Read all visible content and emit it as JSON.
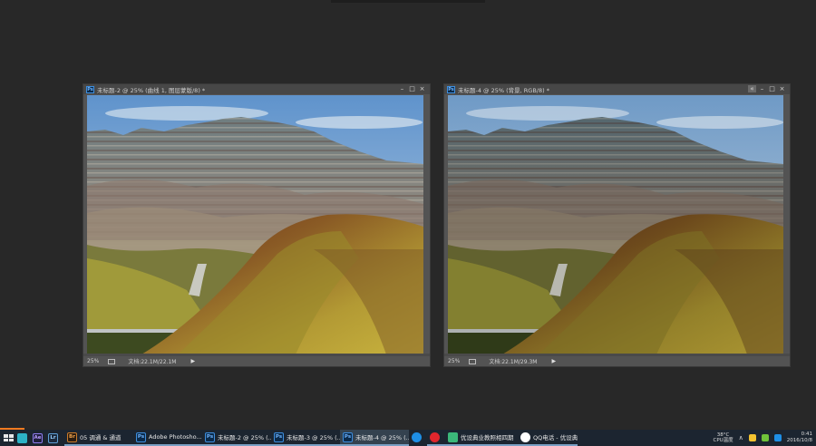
{
  "windows": [
    {
      "title": "未标题-2 @ 25% (曲线 1, 图层蒙版/8) *",
      "ps_icon": "Ps",
      "controls": [
        "–",
        "□",
        "×"
      ],
      "zoom": "25%",
      "doc_size": "文档:22.1M/22.1M",
      "arrow": "▶"
    },
    {
      "title": "未标题-4 @ 25% (背景, RGB/8) *",
      "ps_icon": "Ps",
      "controls": [
        "«",
        "–",
        "□",
        "×"
      ],
      "zoom": "25%",
      "doc_size": "文档:22.1M/29.3M",
      "arrow": "▶"
    }
  ],
  "taskbar": {
    "pinned": [
      {
        "icon": "browser-icon",
        "label": "",
        "color": "#2db2c6"
      },
      {
        "icon": "after-effects-icon",
        "label": "Ae",
        "color": "#1f1e3c"
      },
      {
        "icon": "lightroom-icon",
        "label": "Lr",
        "color": "#1b2a3d"
      }
    ],
    "tasks": [
      {
        "icon": "bridge-icon",
        "icon_label": "Br",
        "label": "05 调通 & 通道"
      },
      {
        "icon": "photoshop-icon",
        "icon_label": "Ps",
        "label": "Adobe Photosho..."
      },
      {
        "icon": "photoshop-icon",
        "icon_label": "Ps",
        "label": "未标题-2 @ 25% (..."
      },
      {
        "icon": "photoshop-icon",
        "icon_label": "Ps",
        "label": "未标题-3 @ 25% (..."
      },
      {
        "icon": "photoshop-icon",
        "icon_label": "Ps",
        "label": "未标题-4 @ 25% (..."
      },
      {
        "icon": "qq-browser-icon",
        "icon_label": "",
        "label": ""
      },
      {
        "icon": "netease-music-icon",
        "icon_label": "",
        "label": ""
      },
      {
        "icon": "app-icon",
        "icon_label": "",
        "label": "优设典业教照相四期"
      },
      {
        "icon": "qq-icon",
        "icon_label": "",
        "label": "QQ电话 - 优设典..."
      }
    ],
    "tray": {
      "temp": "38°C",
      "cpu_label": "CPU温度",
      "time": "0:41",
      "date": "2016/10/8"
    }
  },
  "colors": {
    "app_background": "#282828",
    "document_window": "#535353",
    "taskbar": "#1c2530",
    "accent_orange": "#f57b20"
  }
}
